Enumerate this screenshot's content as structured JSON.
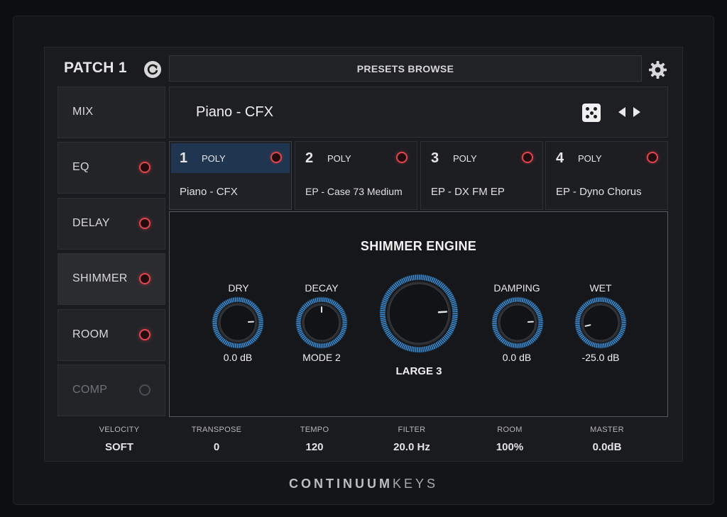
{
  "header": {
    "patch_title": "PATCH 1",
    "presets_browse_label": "PRESETS BROWSE",
    "refresh_icon": "refresh-icon",
    "settings_icon": "gear-icon"
  },
  "sidebar": {
    "items": [
      {
        "label": "MIX",
        "has_led": false,
        "state": "normal"
      },
      {
        "label": "EQ",
        "has_led": true,
        "state": "on"
      },
      {
        "label": "DELAY",
        "has_led": true,
        "state": "on"
      },
      {
        "label": "SHIMMER",
        "has_led": true,
        "state": "on"
      },
      {
        "label": "ROOM",
        "has_led": true,
        "state": "on"
      },
      {
        "label": "COMP",
        "has_led": true,
        "state": "off"
      }
    ]
  },
  "preset": {
    "name": "Piano - CFX",
    "dice_icon": "dice-icon",
    "prev_icon": "arrow-left-icon",
    "next_icon": "arrow-right-icon"
  },
  "slots": [
    {
      "number": "1",
      "mode": "POLY",
      "name": "Piano - CFX",
      "active": true
    },
    {
      "number": "2",
      "mode": "POLY",
      "name": "EP - Case 73 Medium",
      "active": false
    },
    {
      "number": "3",
      "mode": "POLY",
      "name": "EP - DX FM EP",
      "active": false
    },
    {
      "number": "4",
      "mode": "POLY",
      "name": "EP - Dyno Chorus",
      "active": false
    }
  ],
  "engine": {
    "title": "SHIMMER ENGINE",
    "knobs": {
      "dry": {
        "label": "DRY",
        "value": "0.0 dB",
        "level": 0.82
      },
      "decay": {
        "label": "DECAY",
        "value": "MODE 2",
        "level": 0.5
      },
      "size": {
        "label": "",
        "value": "LARGE 3",
        "level": 0.82
      },
      "damping": {
        "label": "DAMPING",
        "value": "0.0 dB",
        "level": 0.82
      },
      "wet": {
        "label": "WET",
        "value": "-25.0 dB",
        "level": 0.12
      }
    }
  },
  "footer": {
    "velocity": {
      "label": "VELOCITY",
      "value": "SOFT"
    },
    "transpose": {
      "label": "TRANSPOSE",
      "value": "0"
    },
    "tempo": {
      "label": "TEMPO",
      "value": "120"
    },
    "filter": {
      "label": "FILTER",
      "value": "20.0 Hz"
    },
    "room": {
      "label": "ROOM",
      "value": "100%"
    },
    "master": {
      "label": "MASTER",
      "value": "0.0dB"
    }
  },
  "brand": {
    "bold": "CONTINUUM",
    "light": "KEYS"
  },
  "colors": {
    "led_on": "#e0464d",
    "knob_ring": "#3a8fd8",
    "active_slot": "#1f3550"
  }
}
